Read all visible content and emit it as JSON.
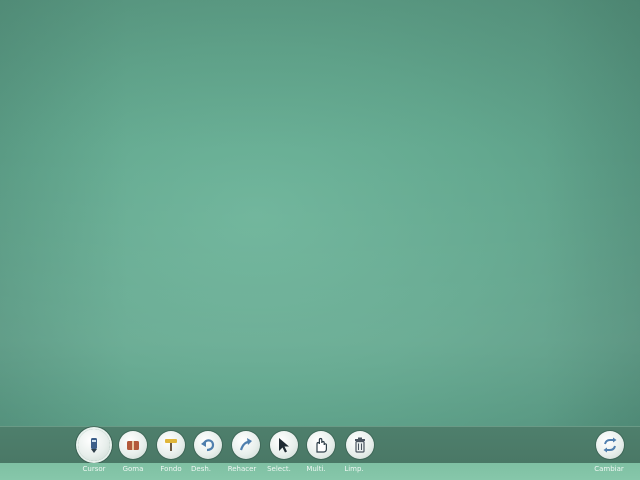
{
  "toolbar": {
    "tools": [
      {
        "label": "Cursor",
        "icon": "pen-icon"
      },
      {
        "label": "Goma",
        "icon": "eraser-icon"
      },
      {
        "label": "Fondo",
        "icon": "paint-roller-icon"
      },
      {
        "label": "Desh.",
        "icon": "undo-icon"
      },
      {
        "label": "Rehacer",
        "icon": "redo-icon"
      },
      {
        "label": "Select.",
        "icon": "select-arrow-icon"
      },
      {
        "label": "Multi.",
        "icon": "multi-touch-hand-icon"
      },
      {
        "label": "Limp.",
        "icon": "trash-icon"
      }
    ],
    "right_tool": {
      "label": "Cambiar",
      "icon": "switch-arrows-icon"
    }
  },
  "colors": {
    "canvas": "#66ad93",
    "toolbar": "#4c7b69",
    "labels_strip": "#82c4a6",
    "icon_dark": "#2f3f4a",
    "icon_blue": "#4f7fae"
  }
}
